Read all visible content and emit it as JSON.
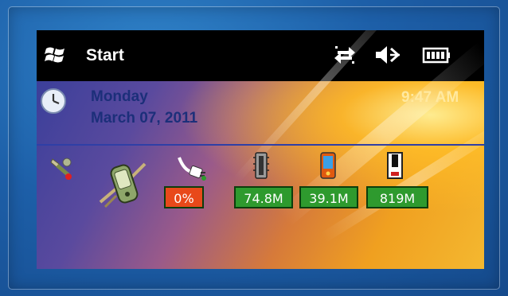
{
  "taskbar": {
    "start_label": "Start",
    "tray_icons": [
      "connectivity-icon",
      "speaker-muted-icon",
      "battery-icon"
    ]
  },
  "today": {
    "day": "Monday",
    "date": "March 07, 2011",
    "time": "9:47 AM"
  },
  "status_plugin": {
    "stats": [
      {
        "icon": "power-plug-icon",
        "value": "0%",
        "color": "#e8491a"
      },
      {
        "icon": "memory-chip-icon",
        "value": "74.8M",
        "color": "#2e9a2e"
      },
      {
        "icon": "pda-storage-icon",
        "value": "39.1M",
        "color": "#2e9a2e"
      },
      {
        "icon": "storage-card-icon",
        "value": "819M",
        "color": "#2e9a2e"
      }
    ]
  },
  "colors": {
    "frame_background": "#1d5fa8",
    "taskbar": "#000000",
    "date_text": "#1c2f7a",
    "time_text": "#ffe9a0",
    "bad_status": "#e8491a",
    "ok_status": "#2e9a2e"
  }
}
